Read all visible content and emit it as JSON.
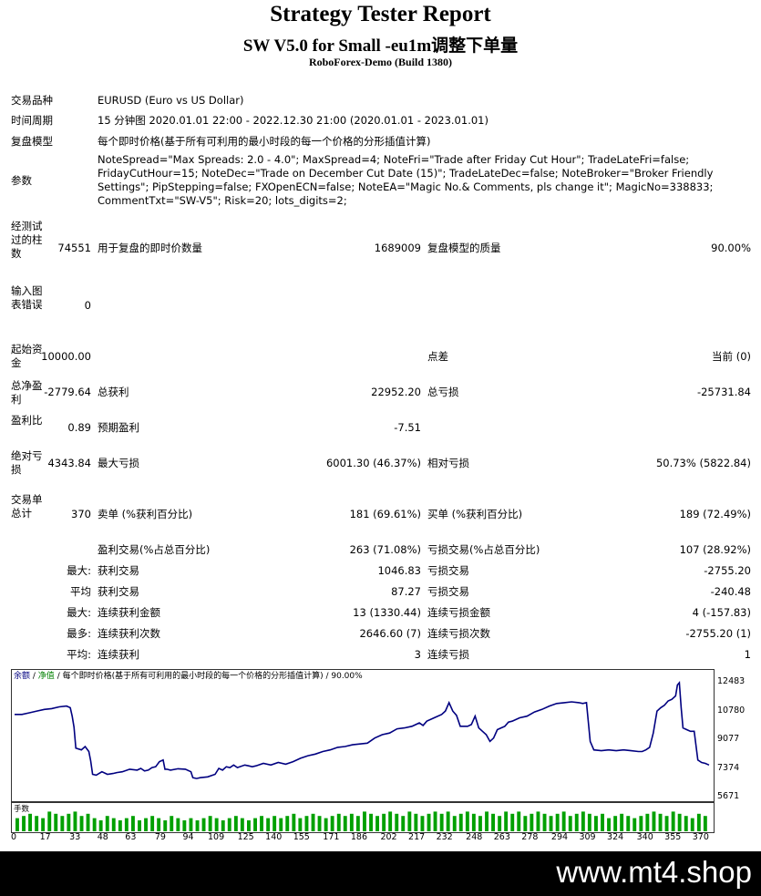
{
  "header": {
    "title": "Strategy Tester Report",
    "subtitle": "SW V5.0 for Small -eu1m调整下单量",
    "server": "RoboForex-Demo (Build 1380)"
  },
  "info": {
    "symbol_label": "交易品种",
    "symbol_value": "EURUSD (Euro vs US Dollar)",
    "period_label": "时间周期",
    "period_value": "15 分钟图 2020.01.01 22:00 - 2022.12.30 21:00 (2020.01.01 - 2023.01.01)",
    "model_label": "复盘模型",
    "model_value": "每个即时价格(基于所有可利用的最小时段的每一个价格的分形插值计算)",
    "params_label": "参数",
    "params_value": "NoteSpread=\"Max Spreads: 2.0 - 4.0\"; MaxSpread=4; NoteFri=\"Trade after Friday Cut Hour\"; TradeLateFri=false; FridayCutHour=15; NoteDec=\"Trade on December Cut Date (15)\"; TradeLateDec=false; NoteBroker=\"Broker Friendly Settings\"; PipStepping=false; FXOpenECN=false; NoteEA=\"Magic No.& Comments, pls change it\"; MagicNo=338833; CommentTxt=\"SW-V5\"; Risk=20; lots_digits=2;"
  },
  "stats": {
    "bars_label": "经测试过的柱数",
    "bars_value": "74551",
    "ticks_label": "用于复盘的即时价数量",
    "ticks_value": "1689009",
    "quality_label": "复盘模型的质量",
    "quality_value": "90.00%",
    "errors_label": "输入图表错误",
    "errors_value": "0",
    "deposit_label": "起始资金",
    "deposit_value": "10000.00",
    "spread_label": "点差",
    "spread_value": "当前 (0)",
    "netprofit_label": "总净盈利",
    "netprofit_value": "-2779.64",
    "grossprofit_label": "总获利",
    "grossprofit_value": "22952.20",
    "grossloss_label": "总亏损",
    "grossloss_value": "-25731.84",
    "pf_label": "盈利比",
    "pf_value": "0.89",
    "expected_label": "预期盈利",
    "expected_value": "-7.51",
    "absdd_label": "绝对亏损",
    "absdd_value": "4343.84",
    "maxdd_label": "最大亏损",
    "maxdd_value": "6001.30 (46.37%)",
    "reldd_label": "相对亏损",
    "reldd_value": "50.73% (5822.84)",
    "trades_label": "交易单总计",
    "trades_value": "370",
    "short_label": "卖单 (%获利百分比)",
    "short_value": "181 (69.61%)",
    "long_label": "买单 (%获利百分比)",
    "long_value": "189 (72.49%)",
    "profit_trades_label": "盈利交易(%占总百分比)",
    "profit_trades_value": "263 (71.08%)",
    "loss_trades_label": "亏损交易(%占总百分比)",
    "loss_trades_value": "107 (28.92%)",
    "largest_prefix": "最大:",
    "largest_profit_label": "获利交易",
    "largest_profit_value": "1046.83",
    "largest_loss_label": "亏损交易",
    "largest_loss_value": "-2755.20",
    "average_prefix": "平均",
    "avg_profit_label": "获利交易",
    "avg_profit_value": "87.27",
    "avg_loss_label": "亏损交易",
    "avg_loss_value": "-240.48",
    "maxcons_prefix": "最大:",
    "maxcons_wins_label": "连续获利金额",
    "maxcons_wins_value": "13 (1330.44)",
    "maxcons_losses_label": "连续亏损金额",
    "maxcons_losses_value": "4 (-157.83)",
    "maximal_prefix": "最多:",
    "maximal_profit_label": "连续获利次数",
    "maximal_profit_value": "2646.60 (7)",
    "maximal_loss_label": "连续亏损次数",
    "maximal_loss_value": "-2755.20 (1)",
    "avgcons_prefix": "平均:",
    "avgcons_wins_label": "连续获利",
    "avgcons_wins_value": "3",
    "avgcons_losses_label": "连续亏损",
    "avgcons_losses_value": "1"
  },
  "chart_data": {
    "type": "line",
    "legend": {
      "balance": "余额",
      "equity": "净值",
      "model": "每个即时价格(基于所有可利用的最小时段的每一个价格的分形插值计算) / 90.00%"
    },
    "volume_label": "手数",
    "yticks": [
      "12483",
      "10780",
      "9077",
      "7374",
      "5671"
    ],
    "ylim": [
      5671,
      12483
    ],
    "xlim": [
      0,
      375
    ],
    "xticks": [
      "0",
      "17",
      "33",
      "48",
      "63",
      "79",
      "94",
      "109",
      "125",
      "140",
      "155",
      "171",
      "186",
      "202",
      "217",
      "232",
      "248",
      "263",
      "278",
      "294",
      "309",
      "324",
      "340",
      "355",
      "370"
    ],
    "series": [
      {
        "color": "#000080",
        "x": [
          0,
          4,
          8,
          12,
          16,
          20,
          24,
          28,
          30,
          31,
          32,
          33,
          36,
          38,
          40,
          41,
          42,
          44,
          47,
          50,
          53,
          55,
          58,
          62,
          66,
          68,
          70,
          72,
          74,
          76,
          78,
          80,
          81,
          82,
          84,
          88,
          92,
          95,
          96,
          98,
          100,
          104,
          108,
          110,
          112,
          114,
          116,
          118,
          120,
          124,
          126,
          128,
          130,
          134,
          138,
          142,
          146,
          150,
          154,
          158,
          162,
          166,
          170,
          174,
          178,
          182,
          186,
          190,
          194,
          198,
          202,
          206,
          210,
          214,
          218,
          220,
          222,
          226,
          230,
          232,
          234,
          236,
          238,
          240,
          244,
          246,
          248,
          250,
          252,
          254,
          256,
          258,
          260,
          262,
          264,
          266,
          268,
          272,
          276,
          280,
          284,
          288,
          292,
          296,
          300,
          304,
          306,
          308,
          310,
          312,
          316,
          320,
          324,
          328,
          332,
          336,
          338,
          340,
          342,
          344,
          346,
          348,
          350,
          352,
          354,
          356,
          357,
          358,
          359,
          360,
          362,
          364,
          366,
          368,
          370,
          372,
          374
        ],
        "y": [
          10600,
          10600,
          10700,
          10800,
          10900,
          10950,
          11050,
          11100,
          11000,
          10500,
          9850,
          8600,
          8500,
          8700,
          8400,
          7850,
          7050,
          7000,
          7200,
          7050,
          7100,
          7150,
          7200,
          7350,
          7300,
          7400,
          7250,
          7300,
          7450,
          7500,
          7800,
          7900,
          7350,
          7350,
          7300,
          7380,
          7350,
          7200,
          6850,
          6800,
          6850,
          6900,
          7050,
          7400,
          7300,
          7500,
          7450,
          7600,
          7450,
          7600,
          7550,
          7500,
          7550,
          7700,
          7600,
          7750,
          7650,
          7800,
          8000,
          8150,
          8250,
          8400,
          8500,
          8650,
          8700,
          8800,
          8850,
          8900,
          9200,
          9400,
          9500,
          9750,
          9800,
          9900,
          10100,
          9950,
          10200,
          10400,
          10600,
          10800,
          11300,
          10800,
          10550,
          9900,
          9900,
          10000,
          10500,
          9800,
          9600,
          9400,
          9000,
          9200,
          9700,
          9800,
          9900,
          10150,
          10200,
          10400,
          10500,
          10750,
          10900,
          11100,
          11250,
          11300,
          11350,
          11300,
          11250,
          11300,
          9000,
          8500,
          8450,
          8500,
          8450,
          8500,
          8450,
          8400,
          8400,
          8500,
          8650,
          9500,
          10800,
          11000,
          11150,
          11400,
          11500,
          11700,
          12350,
          12483,
          11000,
          9800,
          9700,
          9600,
          9600,
          7900,
          7750,
          7700,
          7600
        ]
      }
    ],
    "volume": [
      0.6,
      0.7,
      0.8,
      0.7,
      0.6,
      0.9,
      0.8,
      0.7,
      0.8,
      0.9,
      0.7,
      0.8,
      0.6,
      0.5,
      0.7,
      0.6,
      0.5,
      0.6,
      0.7,
      0.5,
      0.6,
      0.7,
      0.6,
      0.5,
      0.7,
      0.6,
      0.5,
      0.6,
      0.5,
      0.6,
      0.7,
      0.6,
      0.5,
      0.6,
      0.7,
      0.6,
      0.5,
      0.6,
      0.7,
      0.6,
      0.7,
      0.6,
      0.7,
      0.8,
      0.6,
      0.7,
      0.8,
      0.7,
      0.6,
      0.7,
      0.8,
      0.7,
      0.8,
      0.7,
      0.9,
      0.8,
      0.7,
      0.8,
      0.9,
      0.8,
      0.7,
      0.9,
      0.8,
      0.7,
      0.8,
      0.9,
      0.8,
      0.9,
      0.7,
      0.8,
      0.9,
      0.8,
      0.7,
      0.9,
      0.8,
      0.7,
      0.9,
      0.8,
      0.9,
      0.7,
      0.8,
      0.9,
      0.8,
      0.7,
      0.8,
      0.9,
      0.7,
      0.8,
      0.9,
      0.8,
      0.7,
      0.8,
      0.6,
      0.7,
      0.8,
      0.7,
      0.6,
      0.7,
      0.8,
      0.9,
      0.8,
      0.7,
      0.9,
      0.8,
      0.7,
      0.6,
      0.8,
      0.7
    ]
  },
  "footer": {
    "watermark": "www.mt4.shop"
  }
}
